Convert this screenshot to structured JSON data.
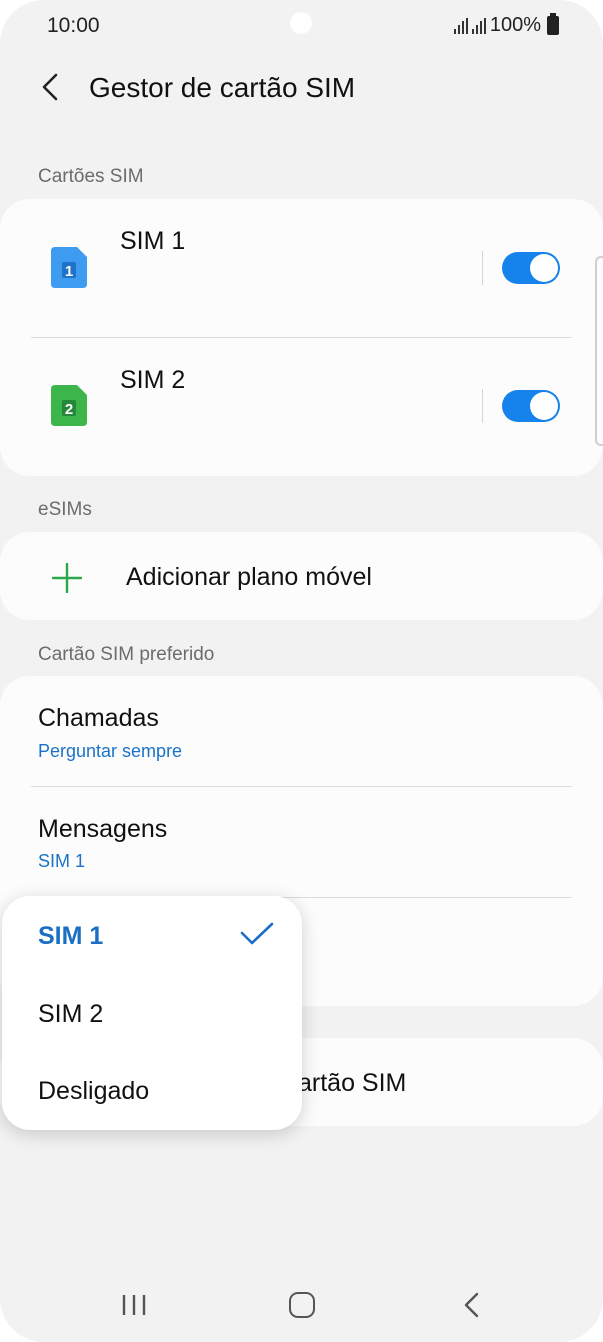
{
  "status_bar": {
    "time": "10:00",
    "battery": "100%"
  },
  "header": {
    "title": "Gestor de cartão SIM"
  },
  "sections": {
    "sim_cards": "Cartões SIM",
    "esims": "eSIMs",
    "preferred": "Cartão SIM preferido"
  },
  "sim_cards": [
    {
      "name": "SIM 1",
      "badge": "1",
      "enabled": true,
      "color": "#3d9bf0"
    },
    {
      "name": "SIM 2",
      "badge": "2",
      "enabled": true,
      "color": "#3cb54a"
    }
  ],
  "esims": {
    "add_label": "Adicionar plano móvel"
  },
  "preferred": {
    "calls": {
      "title": "Chamadas",
      "value": "Perguntar sempre"
    },
    "messages": {
      "title": "Mensagens",
      "value": "SIM 1"
    }
  },
  "behind_popup": {
    "partial_text": "artão SIM"
  },
  "popup": {
    "options": [
      "SIM 1",
      "SIM 2",
      "Desligado"
    ],
    "selected": "SIM 1"
  },
  "colors": {
    "accent": "#1683ec",
    "link": "#1a73c8",
    "plus": "#2aa84a"
  }
}
